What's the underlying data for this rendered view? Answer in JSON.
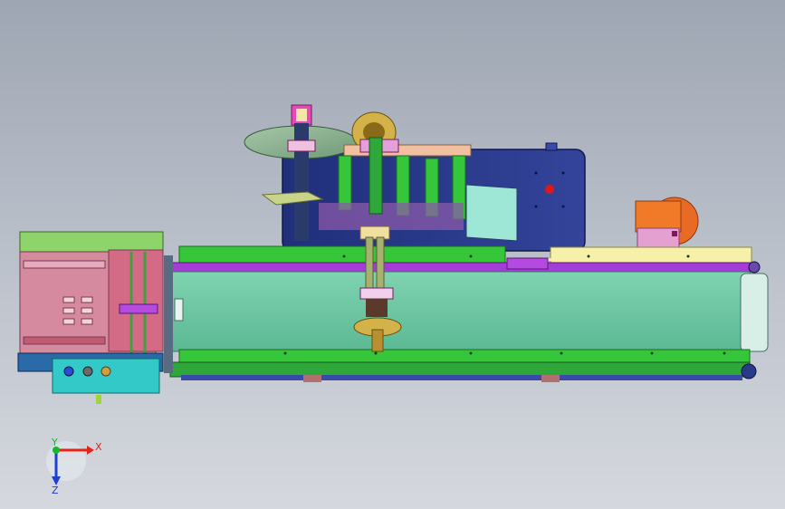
{
  "triad": {
    "x_label": "X",
    "y_label": "Y",
    "z_label": "Z",
    "x_color": "#e8221b",
    "y_color": "#16b92e",
    "z_color": "#1d3fd6"
  },
  "colors": {
    "background_top": "#9ea6b3",
    "background_bottom": "#d5d8de",
    "conveyor_green": "#36c63a",
    "conveyor_belt": "#6fc8a4",
    "purple": "#a43cd8",
    "navy": "#2a3a8a",
    "pink": "#d58aa0",
    "cyan": "#34c9c9",
    "orange": "#f07a28",
    "cream": "#f6f0a8",
    "mint": "#9ee6d6"
  }
}
